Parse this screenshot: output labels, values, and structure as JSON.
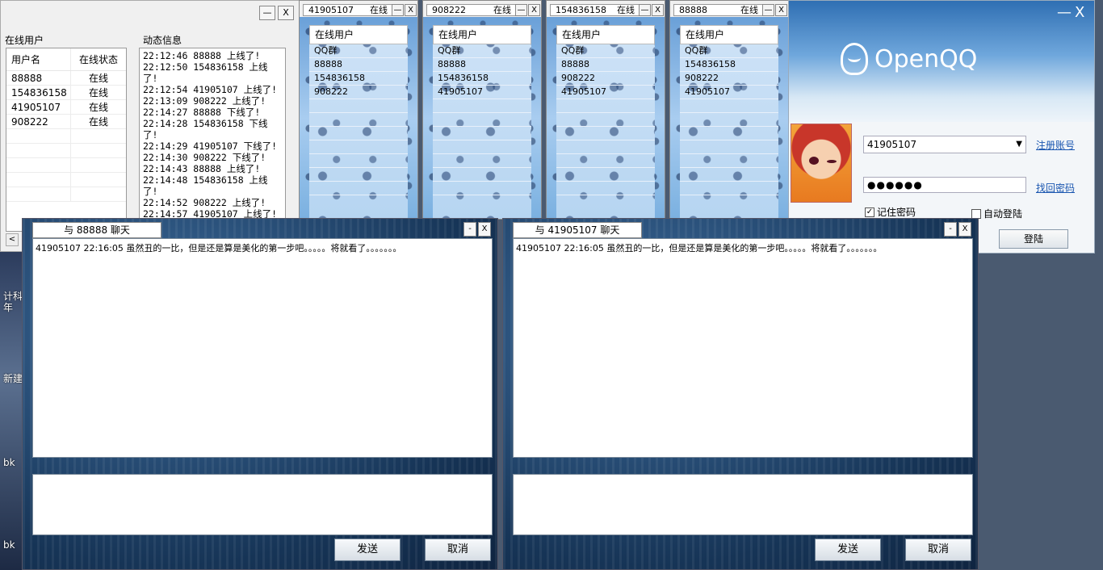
{
  "desktop": {
    "label1": "计科",
    "label2": "年",
    "label3": "新建",
    "label4": "bk",
    "label5": "bk"
  },
  "server": {
    "min_label": "—",
    "close_label": "X",
    "users_group": "在线用户",
    "log_group": "动态信息",
    "columns": [
      "用户名",
      "在线状态"
    ],
    "rows": [
      {
        "name": "88888",
        "status": "在线"
      },
      {
        "name": "154836158",
        "status": "在线"
      },
      {
        "name": "41905107",
        "status": "在线"
      },
      {
        "name": "908222",
        "status": "在线"
      }
    ],
    "scroll_left": "<",
    "log": [
      "22:12:46 88888 上线了!",
      "22:12:50 154836158 上线了!",
      "22:12:54 41905107 上线了!",
      "22:13:09 908222 上线了!",
      "22:14:27 88888 下线了!",
      "22:14:28 154836158 下线了!",
      "22:14:29 41905107 下线了!",
      "22:14:30 908222 下线了!",
      "22:14:43 88888 上线了!",
      "22:14:48 154836158 上线了!",
      "22:14:52 908222 上线了!",
      "22:14:57 41905107 上线了!"
    ]
  },
  "clients": [
    {
      "user": "41905107",
      "status": "在线",
      "header": "在线用户",
      "items": [
        "QQ群",
        "88888",
        "154836158",
        "908222"
      ]
    },
    {
      "user": "908222",
      "status": "在线",
      "header": "在线用户",
      "items": [
        "QQ群",
        "88888",
        "154836158",
        "41905107"
      ]
    },
    {
      "user": "154836158",
      "status": "在线",
      "header": "在线用户",
      "items": [
        "QQ群",
        "88888",
        "908222",
        "41905107"
      ]
    },
    {
      "user": "88888",
      "status": "在线",
      "header": "在线用户",
      "items": [
        "QQ群",
        "154836158",
        "908222",
        "41905107"
      ]
    }
  ],
  "client_btns": {
    "min": "—",
    "close": "X"
  },
  "login": {
    "app_name": "OpenQQ",
    "min_label": "—",
    "close_label": "X",
    "account": "41905107",
    "password_mask": "●●●●●●",
    "register_link": "注册账号",
    "recover_link": "找回密码",
    "remember_label": "记住密码",
    "remember_checked": "✓",
    "auto_label": "自动登陆",
    "login_button": "登陆"
  },
  "chats": [
    {
      "title": "与 88888 聊天",
      "message": "41905107   22:16:05 虽然丑的一比，但是还是算是美化的第一步吧。。。。。将就看了。。。。。。。",
      "send": "发送",
      "cancel": "取消"
    },
    {
      "title": "与 41905107 聊天",
      "message": "41905107   22:16:05 虽然丑的一比，但是还是算是美化的第一步吧。。。。。将就看了。。。。。。。",
      "send": "发送",
      "cancel": "取消"
    }
  ],
  "chat_btns": {
    "min": "-",
    "close": "X"
  }
}
